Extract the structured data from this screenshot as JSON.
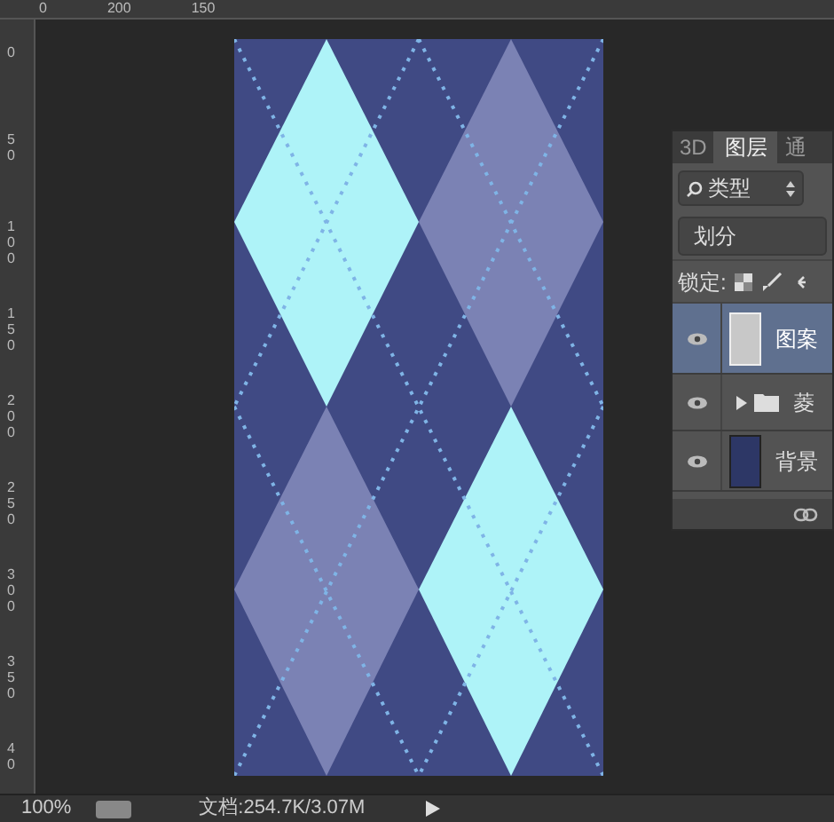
{
  "rulers": {
    "top_labels": [
      "0",
      "200",
      "150"
    ],
    "left_labels": [
      "0",
      "50",
      "100",
      "150",
      "200",
      "250",
      "300",
      "350",
      "40"
    ]
  },
  "layers_panel": {
    "tabs": [
      {
        "label": "3D",
        "selected": false
      },
      {
        "label": "图层",
        "selected": true
      },
      {
        "label": "通",
        "selected": false
      }
    ],
    "filter": {
      "value": "类型"
    },
    "blend_mode": {
      "value": "划分"
    },
    "lock_label": "锁定:",
    "layers": [
      {
        "kind": "layer",
        "name": "图案",
        "selected": true,
        "visible": true,
        "color": "#c8c8c8"
      },
      {
        "kind": "group",
        "name": "菱",
        "selected": false,
        "visible": true,
        "expanded": false
      },
      {
        "kind": "layer",
        "name": "背景",
        "selected": false,
        "visible": true,
        "color": "#2d3766"
      }
    ]
  },
  "status_bar": {
    "zoom": "100%",
    "document": "文档:254.7K/3.07M"
  }
}
